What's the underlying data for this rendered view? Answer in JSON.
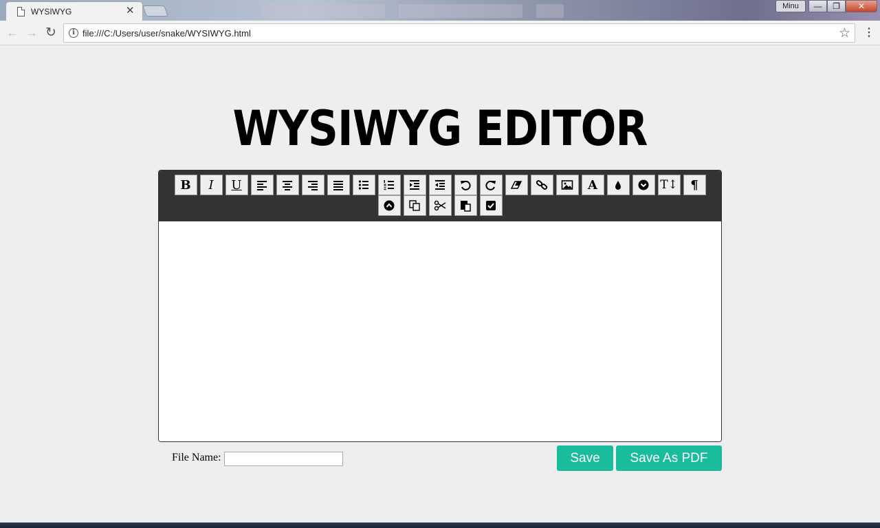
{
  "browser": {
    "tab_title": "WYSIWYG",
    "tab_close": "✕",
    "window_label": "Minu",
    "url": "file:///C:/Users/user/snake/WYSIWYG.html"
  },
  "page": {
    "title": "WYSIWYG EDITOR"
  },
  "toolbar": {
    "bold": "B",
    "italic": "I",
    "underline": "U",
    "font_color": "A",
    "heading": "T↕",
    "paragraph": "¶"
  },
  "form": {
    "file_name_label": "File Name:",
    "file_name_value": "",
    "save_label": "Save",
    "save_pdf_label": "Save As PDF"
  },
  "colors": {
    "accent": "#1abc9c",
    "toolbar_bg": "#333333",
    "page_bg": "#eeeeee"
  }
}
